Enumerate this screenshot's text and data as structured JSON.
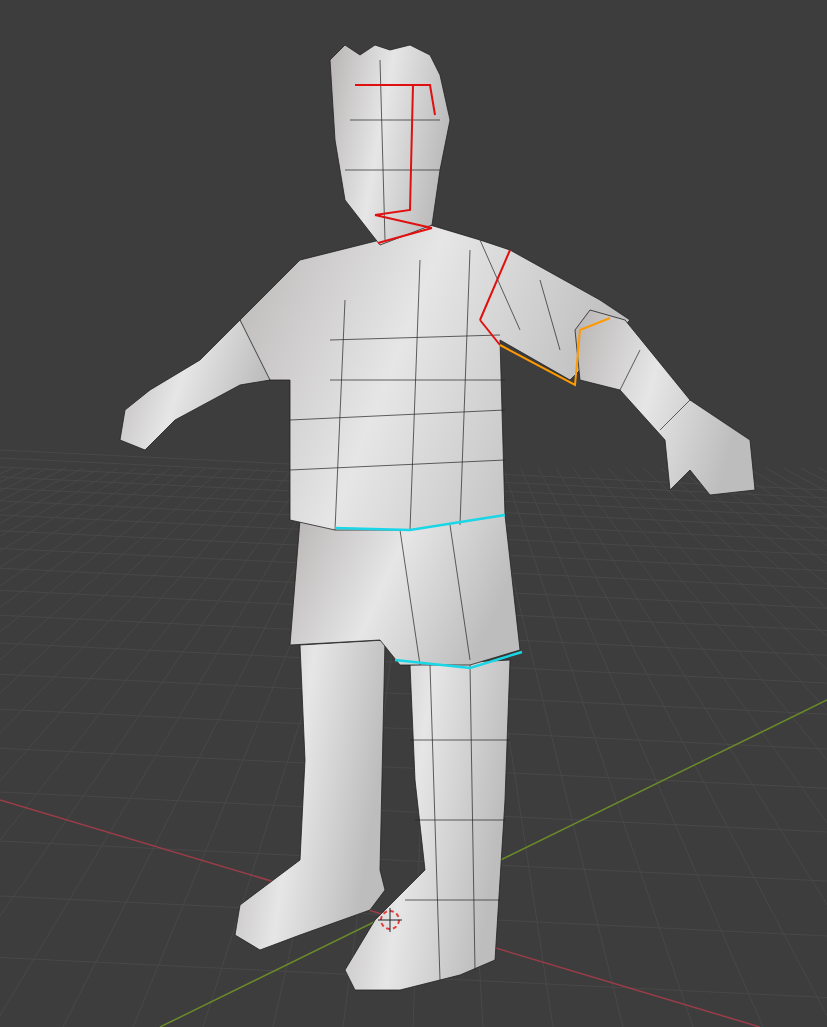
{
  "viewport": {
    "show_grid": true,
    "show_axes": true,
    "show_cursor": true,
    "show_wireframe": true
  }
}
